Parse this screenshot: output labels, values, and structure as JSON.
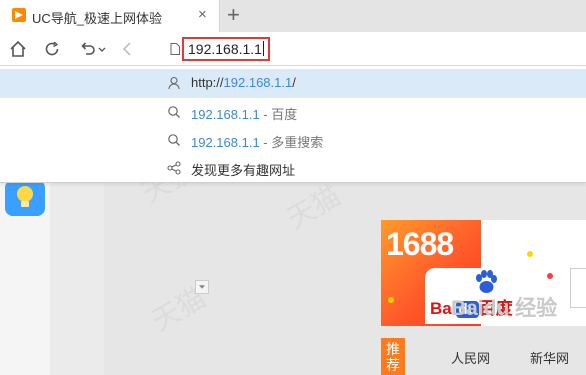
{
  "tab": {
    "title": "UC导航_极速上网体验",
    "close_glyph": "×",
    "favicon_color": "#ff8a00"
  },
  "new_tab_glyph": "+",
  "address": {
    "value": "192.168.1.1"
  },
  "suggestions": [
    {
      "icon": "person-icon",
      "prefix": "http://",
      "host": "192.168.1.1",
      "suffix": "/"
    },
    {
      "icon": "search-icon",
      "prefix": "",
      "host": "192.168.1.1",
      "suffix": " - 百度"
    },
    {
      "icon": "search-icon",
      "prefix": "",
      "host": "192.168.1.1",
      "suffix": " - 多重搜索"
    },
    {
      "icon": "share-icon",
      "prefix": "",
      "host": "",
      "suffix": "发现更多有趣网址"
    }
  ],
  "page": {
    "ad": {
      "brand": "1688",
      "baidu_pre": "Bai",
      "baidu_du": "du",
      "baidu_cn": "百度"
    },
    "recommend_label": "推荐",
    "links": [
      "人民网",
      "新华网"
    ],
    "watermarks": [
      "天猫",
      "天猫",
      "天猫"
    ],
    "jingyan_watermark": "Baidu 经验"
  },
  "colors": {
    "accent_blue": "#3c88d8",
    "address_outline": "#e53935",
    "suggestion_highlight": "#dbeaf8",
    "orange": "#ff7a1a"
  }
}
